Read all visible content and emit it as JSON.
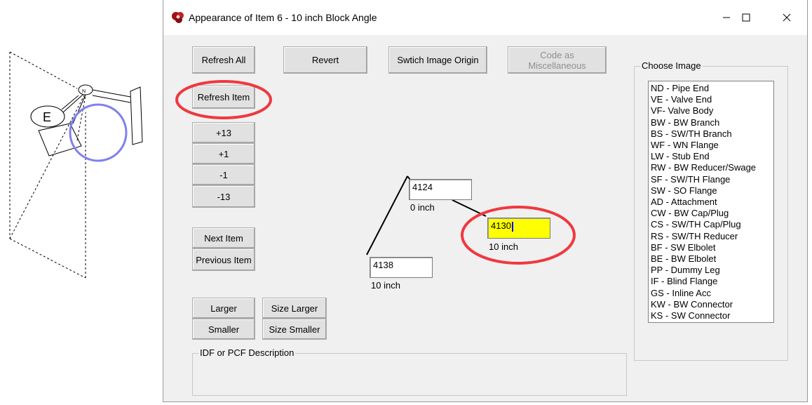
{
  "sketch": {
    "label": "E"
  },
  "window": {
    "title": "Appearance of Item 6  -  10 inch Block Angle",
    "controls": {
      "minimize": "—",
      "maximize": "☐",
      "close": "✕"
    }
  },
  "buttons": {
    "refresh_all": "Refresh All",
    "revert": "Revert",
    "switch_origin": "Swtich Image Origin",
    "code_misc": "Code as\nMiscellaneous",
    "refresh_item": "Refresh Item",
    "plus13": "+13",
    "plus1": "+1",
    "minus1": "-1",
    "minus13": "-13",
    "next_item": "Next Item",
    "previous_item": "Previous Item",
    "larger": "Larger",
    "smaller": "Smaller",
    "size_larger": "Size Larger",
    "size_smaller": "Size Smaller"
  },
  "points": {
    "top": {
      "value": "4124",
      "caption": "0 inch"
    },
    "right": {
      "value": "4130",
      "caption": "10 inch"
    },
    "bottom": {
      "value": "4138",
      "caption": "10 inch"
    }
  },
  "description": {
    "legend": "IDF or PCF Description"
  },
  "choose_image": {
    "legend": "Choose Image",
    "items": [
      "ND - Pipe End",
      "VE - Valve End",
      "VF- Valve Body",
      "BW - BW Branch",
      "BS - SW/TH Branch",
      "WF - WN Flange",
      "LW - Stub End",
      "RW - BW Reducer/Swage",
      "SF - SW/TH Flange",
      "SW - SO Flange",
      "AD - Attachment",
      "CW - BW Cap/Plug",
      "CS - SW/TH Cap/Plug",
      "RS - SW/TH Reducer",
      "BF - SW Elbolet",
      "BE - BW Elbolet",
      "PP - Dummy Leg",
      "IF - Blind Flange",
      "GS - Inline Acc",
      "KW - BW Connector",
      "KS - SW Connector"
    ]
  },
  "colors": {
    "annotation_red": "#f0383f",
    "annotation_blue": "#8080f0",
    "highlight": "#ffff00"
  }
}
